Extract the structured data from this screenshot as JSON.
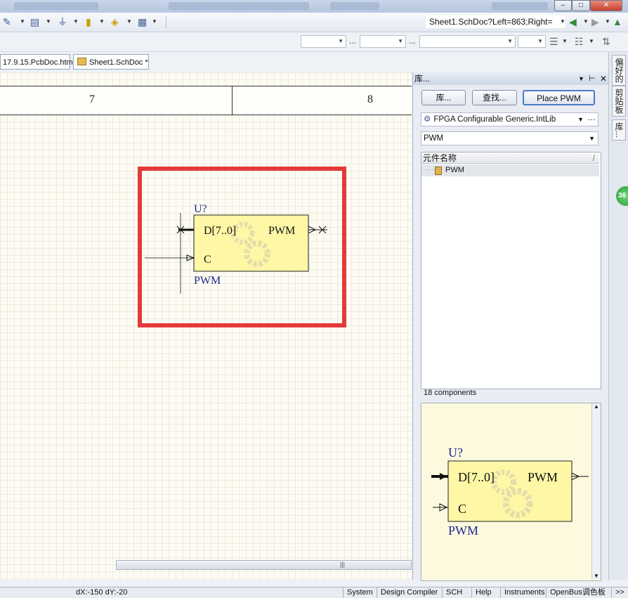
{
  "nav": {
    "address": "Sheet1.SchDoc?Left=863;Right="
  },
  "tabs": [
    {
      "label": "17.9.15.PcbDoc.htm"
    },
    {
      "label": "Sheet1.SchDoc *"
    }
  ],
  "sheet": {
    "zone_numbers": [
      "7",
      "8"
    ],
    "component": {
      "designator": "U?",
      "comment": "PWM",
      "pins": [
        "D[7..0]",
        "C",
        "PWM"
      ]
    }
  },
  "library_panel": {
    "title": "库...",
    "buttons": {
      "libraries": "库...",
      "search": "查找...",
      "place": "Place PWM"
    },
    "library": "FPGA Configurable Generic.IntLib",
    "filter": "PWM",
    "column_header": "元件名称",
    "items": [
      "PWM"
    ],
    "count_text": "18 components",
    "preview": {
      "designator": "U?",
      "comment": "PWM",
      "pins": [
        "D[7..0]",
        "C",
        "PWM"
      ]
    }
  },
  "side_tabs": [
    "偏好的",
    "剪贴板",
    "库..."
  ],
  "badge": "36",
  "status": {
    "coords": "dX:-150 dY:-20",
    "tabs": [
      "System",
      "Design Compiler",
      "SCH",
      "Help",
      "Instruments",
      "OpenBus调色板",
      ">>"
    ]
  }
}
